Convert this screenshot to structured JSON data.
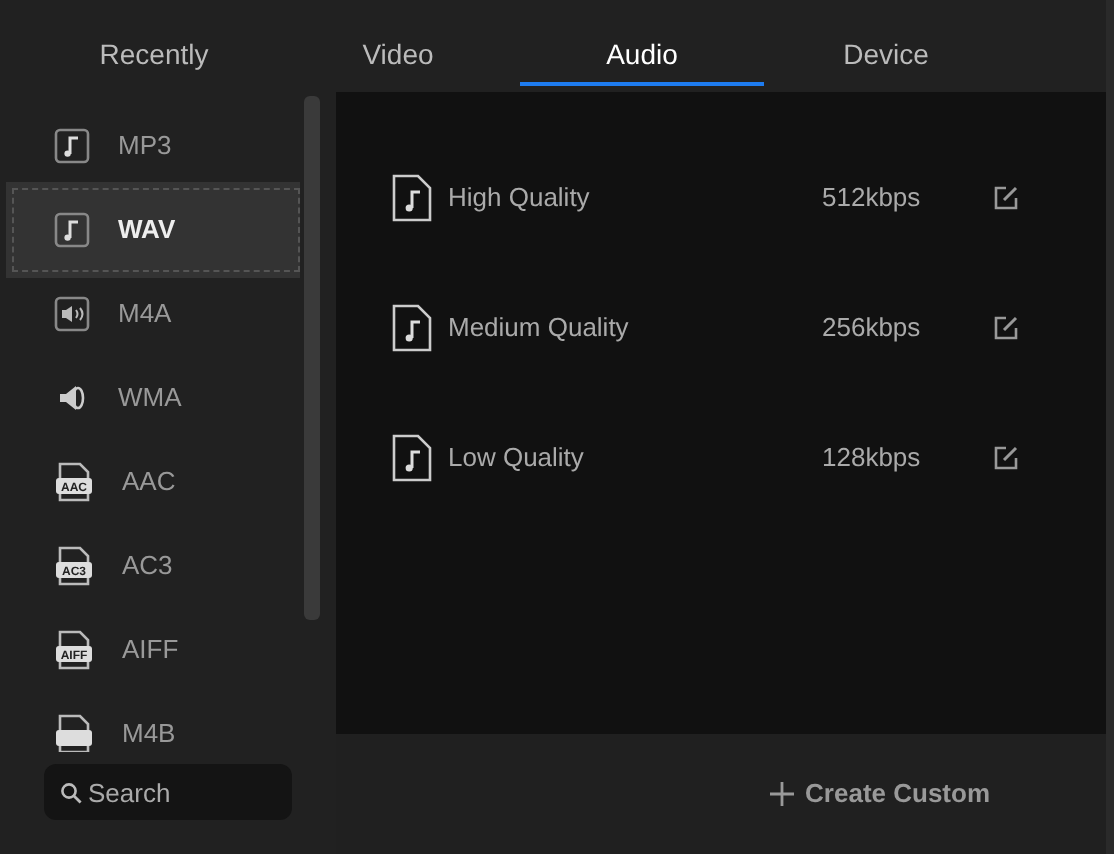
{
  "tabs": [
    {
      "label": "Recently",
      "selected": false
    },
    {
      "label": "Video",
      "selected": false
    },
    {
      "label": "Audio",
      "selected": true
    },
    {
      "label": "Device",
      "selected": false
    }
  ],
  "formats": [
    {
      "label": "MP3",
      "kind": "note",
      "selected": false
    },
    {
      "label": "WAV",
      "kind": "note",
      "selected": true
    },
    {
      "label": "M4A",
      "kind": "speaker-box",
      "selected": false
    },
    {
      "label": "WMA",
      "kind": "speaker",
      "selected": false
    },
    {
      "label": "AAC",
      "kind": "file",
      "icon_label": "AAC",
      "selected": false
    },
    {
      "label": "AC3",
      "kind": "file",
      "icon_label": "AC3",
      "selected": false
    },
    {
      "label": "AIFF",
      "kind": "file",
      "icon_label": "AIFF",
      "selected": false
    },
    {
      "label": "M4B",
      "kind": "file",
      "selected": false
    }
  ],
  "search": {
    "placeholder": "Search"
  },
  "presets": [
    {
      "name": "High Quality",
      "bitrate": "512kbps"
    },
    {
      "name": "Medium Quality",
      "bitrate": "256kbps"
    },
    {
      "name": "Low Quality",
      "bitrate": "128kbps"
    }
  ],
  "create_button": {
    "label": "Create Custom"
  }
}
